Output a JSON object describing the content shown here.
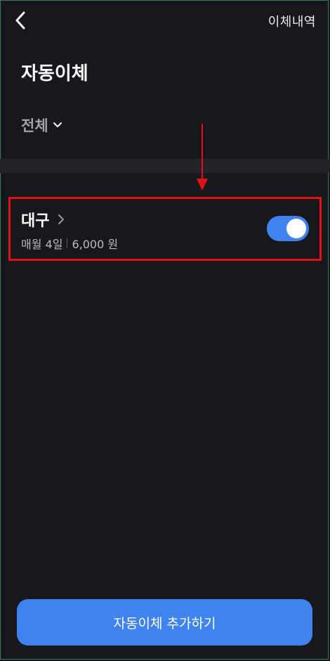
{
  "header": {
    "back_icon": "chevron-left-icon",
    "history_label": "이체내역"
  },
  "page": {
    "title": "자동이체"
  },
  "filter": {
    "label": "전체",
    "icon": "chevron-down-icon"
  },
  "annotation": {
    "arrow_color": "#e00f18",
    "box_color": "#e00f18"
  },
  "transfers": [
    {
      "name": "대구",
      "schedule": "매월 4일",
      "amount": "6,000 원",
      "enabled": true
    }
  ],
  "footer": {
    "add_button_label": "자동이체 추가하기"
  },
  "colors": {
    "background": "#18181c",
    "accent": "#3f83f0"
  }
}
